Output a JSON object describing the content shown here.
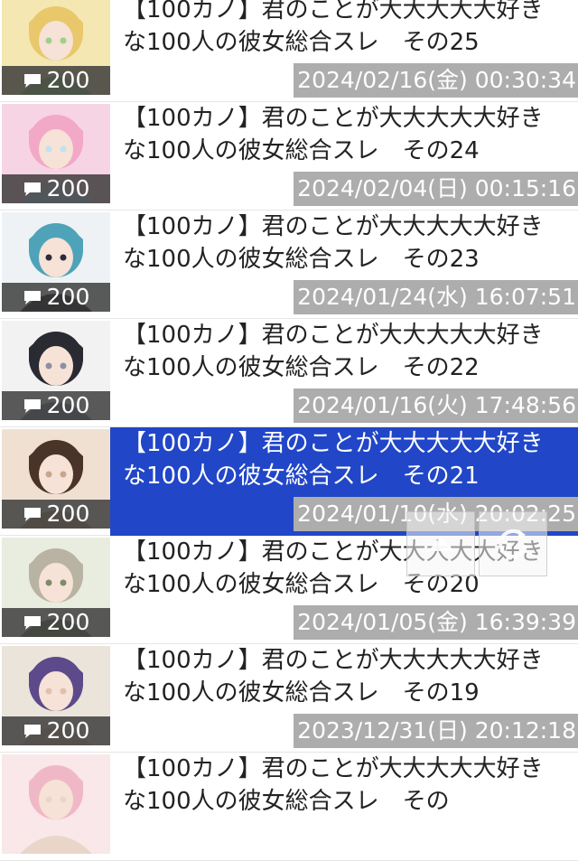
{
  "colors": {
    "selected_bg": "#2146c7",
    "date_bg": "#adadad",
    "badge_bg": "#373737"
  },
  "threads": [
    {
      "title": "【100カノ】君のことが大大大大大好きな100人の彼女総合スレ　その25",
      "date": "2024/02/16(金) 00:30:34",
      "count": "200",
      "selected": false,
      "palette": [
        "#f4e7b2",
        "#e8c86a",
        "#9fd08a"
      ]
    },
    {
      "title": "【100カノ】君のことが大大大大大好きな100人の彼女総合スレ　その24",
      "date": "2024/02/04(日) 00:15:16",
      "count": "200",
      "selected": false,
      "palette": [
        "#f7d4e4",
        "#f2a8c7",
        "#bfe3f2"
      ]
    },
    {
      "title": "【100カノ】君のことが大大大大大好きな100人の彼女総合スレ　その23",
      "date": "2024/01/24(水) 16:07:51",
      "count": "200",
      "selected": false,
      "palette": [
        "#eef2f5",
        "#4fa3b8",
        "#2b2b3a"
      ]
    },
    {
      "title": "【100カノ】君のことが大大大大大好きな100人の彼女総合スレ　その22",
      "date": "2024/01/16(火) 17:48:56",
      "count": "200",
      "selected": false,
      "palette": [
        "#f2f2f2",
        "#2a2a33",
        "#8d8fa3"
      ]
    },
    {
      "title": "【100カノ】君のことが大大大大大好きな100人の彼女総合スレ　その21",
      "date": "2024/01/10(水) 20:02:25",
      "count": "200",
      "selected": true,
      "palette": [
        "#efe0d2",
        "#4a3328",
        "#c9a58c"
      ]
    },
    {
      "title": "【100カノ】君のことが大大大大大好きな100人の彼女総合スレ　その20",
      "date": "2024/01/05(金) 16:39:39",
      "count": "200",
      "selected": false,
      "palette": [
        "#e8ede0",
        "#b9b3a4",
        "#7e8b6a"
      ]
    },
    {
      "title": "【100カノ】君のことが大大大大大好きな100人の彼女総合スレ　その19",
      "date": "2023/12/31(日) 20:12:18",
      "count": "200",
      "selected": false,
      "palette": [
        "#ebe4da",
        "#5c4a8a",
        "#e1c0ae"
      ]
    },
    {
      "title": "【100カノ】君のことが大大大大大好きな100人の彼女総合スレ　その",
      "date": "",
      "count": "",
      "selected": false,
      "palette": [
        "#f9e7ea",
        "#f0b8c6",
        "#e9d6c8"
      ]
    }
  ],
  "overlay": {
    "scroll_top_icon": "chevron-up-icon",
    "refresh_icon": "refresh-icon"
  }
}
